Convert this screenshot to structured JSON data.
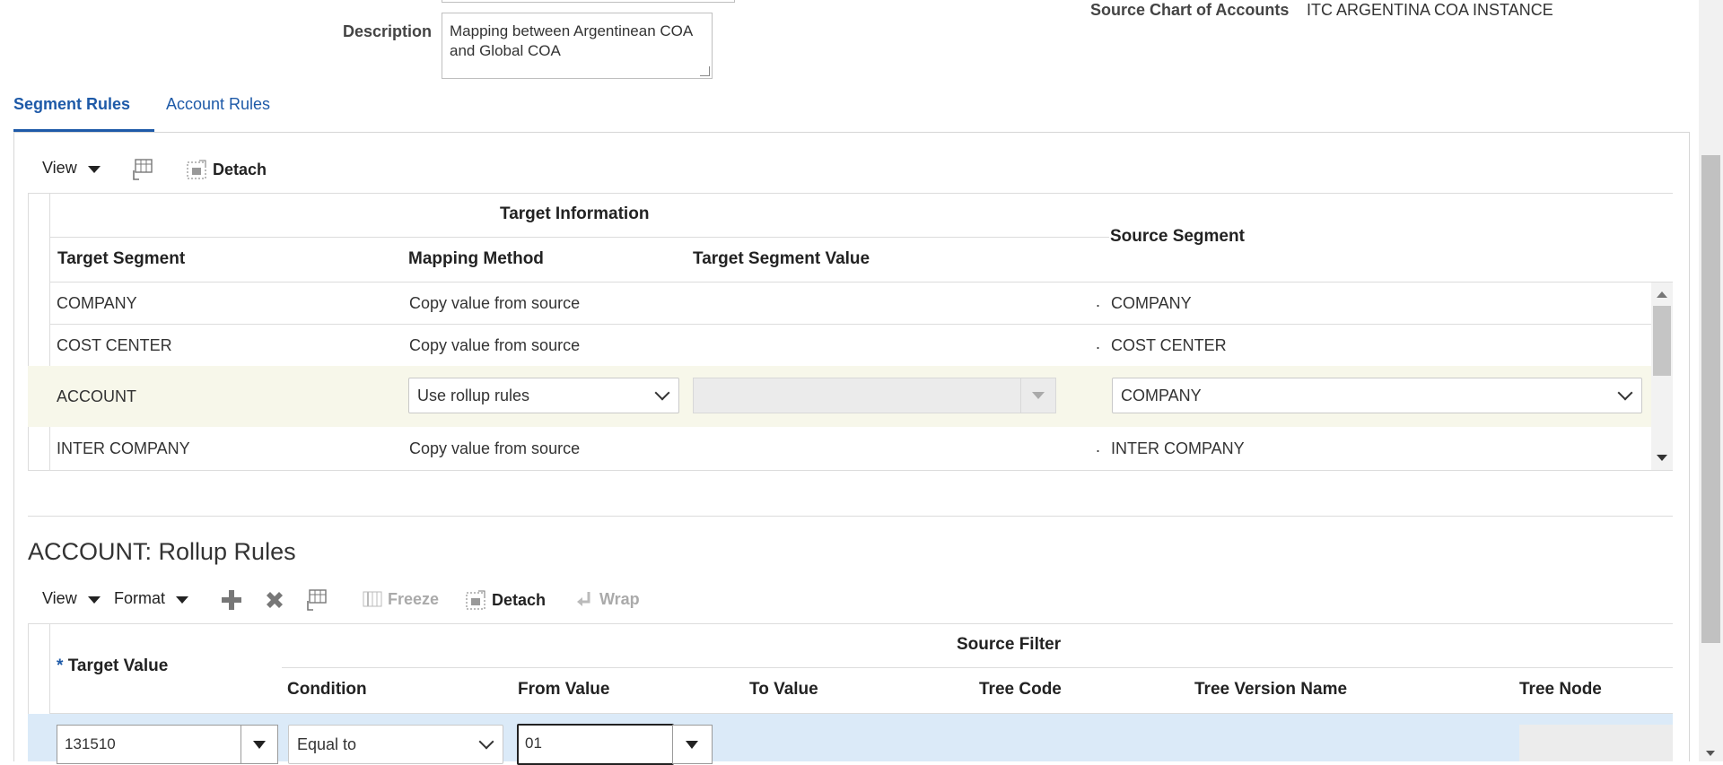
{
  "form": {
    "description_label": "Description",
    "description_value": "Mapping between Argentinean COA and Global COA",
    "source_coa_label": "Source Chart of Accounts",
    "source_coa_value": "ITC ARGENTINA COA INSTANCE"
  },
  "tabs": [
    {
      "label": "Segment Rules",
      "active": true
    },
    {
      "label": "Account Rules",
      "active": false
    }
  ],
  "segment_toolbar": {
    "view_label": "View",
    "detach_label": "Detach"
  },
  "segment_table": {
    "group_header": "Target Information",
    "columns": {
      "target_segment": "Target Segment",
      "mapping_method": "Mapping Method",
      "target_segment_value": "Target Segment Value",
      "source_segment": "Source Segment"
    },
    "rows": [
      {
        "target_segment": "COMPANY",
        "mapping_method": "Copy value from source",
        "target_segment_value": "",
        "dot": ".",
        "source_segment": "COMPANY"
      },
      {
        "target_segment": "COST CENTER",
        "mapping_method": "Copy value from source",
        "target_segment_value": "",
        "dot": ".",
        "source_segment": "COST CENTER"
      },
      {
        "target_segment": "ACCOUNT",
        "mapping_method": "Use rollup rules",
        "target_segment_value": "",
        "dot": "",
        "source_segment": "COMPANY"
      },
      {
        "target_segment": "INTER COMPANY",
        "mapping_method": "Copy value from source",
        "target_segment_value": "",
        "dot": ".",
        "source_segment": "INTER COMPANY"
      }
    ]
  },
  "rollup": {
    "title": "ACCOUNT: Rollup Rules",
    "toolbar": {
      "view_label": "View",
      "format_label": "Format",
      "freeze_label": "Freeze",
      "detach_label": "Detach",
      "wrap_label": "Wrap"
    },
    "required_marker": "*",
    "columns": {
      "target_value": "Target Value",
      "source_filter": "Source Filter",
      "condition": "Condition",
      "from_value": "From Value",
      "to_value": "To Value",
      "tree_code": "Tree Code",
      "tree_version_name": "Tree Version Name",
      "tree_node": "Tree Node"
    },
    "row": {
      "target_value": "131510",
      "condition": "Equal to",
      "from_value": "01"
    }
  },
  "colors": {
    "accent": "#1e5aa8",
    "selected_row": "#f7f7ea",
    "edit_row": "#dbeaf8"
  }
}
